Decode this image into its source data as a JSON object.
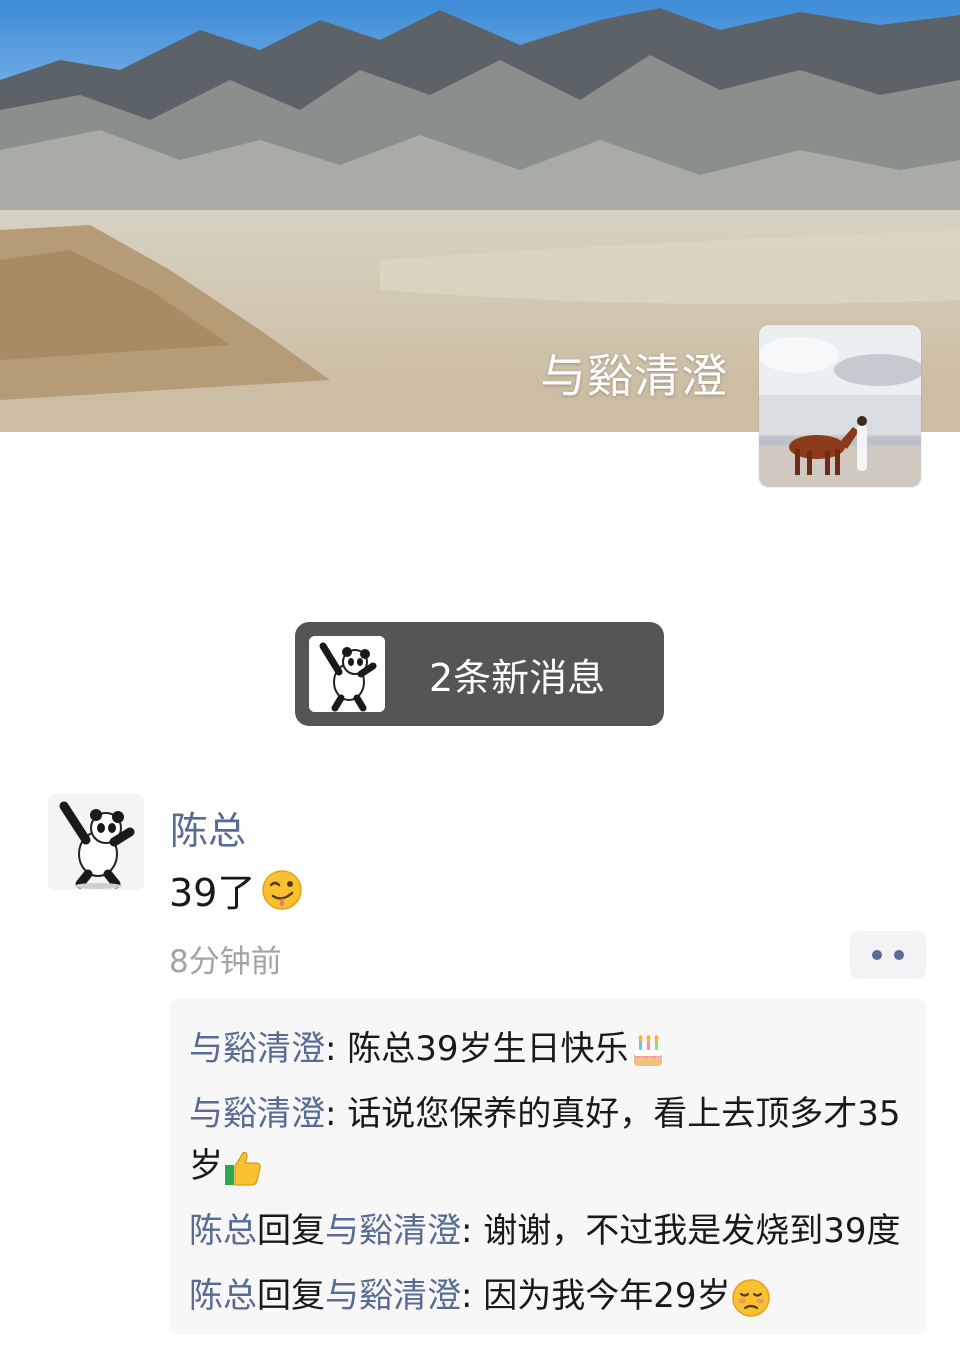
{
  "cover": {
    "nickname": "与谿清澄"
  },
  "new_message": {
    "label": "2条新消息"
  },
  "post": {
    "author": "陈总",
    "text": "39了",
    "time": "8分钟前",
    "emoji_icon": "drooling-face-emoji"
  },
  "comments": [
    {
      "user": "与谿清澄",
      "sep": ": ",
      "text": "陈总39岁生日快乐",
      "emoji": "birthday-cake-emoji"
    },
    {
      "user": "与谿清澄",
      "sep": ": ",
      "text": "话说您保养的真好，看上去顶多才35岁",
      "emoji": "thumbs-up-emoji"
    },
    {
      "user": "陈总",
      "reply_word": "回复",
      "reply_to": "与谿清澄",
      "sep": ": ",
      "text": "谢谢，不过我是发烧到39度"
    },
    {
      "user": "陈总",
      "reply_word": "回复",
      "reply_to": "与谿清澄",
      "sep": ": ",
      "text": "因为我今年29岁",
      "emoji": "feverish-face-emoji"
    }
  ],
  "colors": {
    "link": "#576b95",
    "text": "#191919",
    "muted": "#a3a3a3",
    "banner_bg": "#555555"
  }
}
